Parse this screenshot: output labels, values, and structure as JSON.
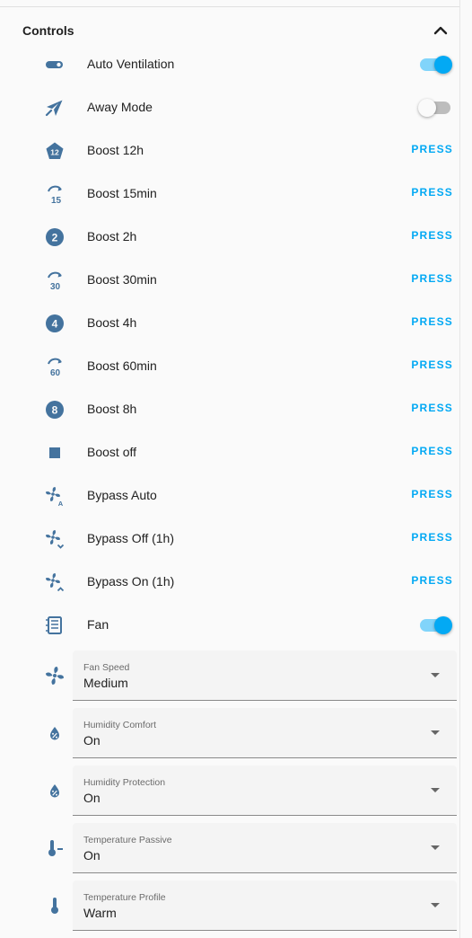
{
  "header": {
    "title": "Controls"
  },
  "colors": {
    "icon": "#44739e",
    "accent": "#03a9f4"
  },
  "rows": [
    {
      "label": "Auto Ventilation",
      "control": "toggle",
      "state": "on",
      "icon": "toggle-switch-icon"
    },
    {
      "label": "Away Mode",
      "control": "toggle",
      "state": "off",
      "icon": "airplane-icon"
    },
    {
      "label": "Boost 12h",
      "control": "button",
      "action": "PRESS",
      "icon": "numeric-12-pentagon-icon"
    },
    {
      "label": "Boost 15min",
      "control": "button",
      "action": "PRESS",
      "icon": "timer-15-icon"
    },
    {
      "label": "Boost 2h",
      "control": "button",
      "action": "PRESS",
      "icon": "numeric-2-circle-icon"
    },
    {
      "label": "Boost 30min",
      "control": "button",
      "action": "PRESS",
      "icon": "timer-30-icon"
    },
    {
      "label": "Boost 4h",
      "control": "button",
      "action": "PRESS",
      "icon": "numeric-4-circle-icon"
    },
    {
      "label": "Boost 60min",
      "control": "button",
      "action": "PRESS",
      "icon": "timer-60-icon"
    },
    {
      "label": "Boost 8h",
      "control": "button",
      "action": "PRESS",
      "icon": "numeric-8-circle-icon"
    },
    {
      "label": "Boost off",
      "control": "button",
      "action": "PRESS",
      "icon": "stop-icon"
    },
    {
      "label": "Bypass Auto",
      "control": "button",
      "action": "PRESS",
      "icon": "fan-auto-icon"
    },
    {
      "label": "Bypass Off (1h)",
      "control": "button",
      "action": "PRESS",
      "icon": "fan-chevron-down-icon"
    },
    {
      "label": "Bypass On (1h)",
      "control": "button",
      "action": "PRESS",
      "icon": "fan-chevron-up-icon"
    },
    {
      "label": "Fan",
      "control": "toggle",
      "state": "on",
      "icon": "air-filter-icon"
    }
  ],
  "selects": [
    {
      "label": "Fan Speed",
      "value": "Medium",
      "icon": "fan-icon"
    },
    {
      "label": "Humidity Comfort",
      "value": "On",
      "icon": "water-percent-icon"
    },
    {
      "label": "Humidity Protection",
      "value": "On",
      "icon": "water-percent-icon"
    },
    {
      "label": "Temperature Passive",
      "value": "On",
      "icon": "thermometer-minus-icon"
    },
    {
      "label": "Temperature Profile",
      "value": "Warm",
      "icon": "thermometer-icon"
    }
  ]
}
